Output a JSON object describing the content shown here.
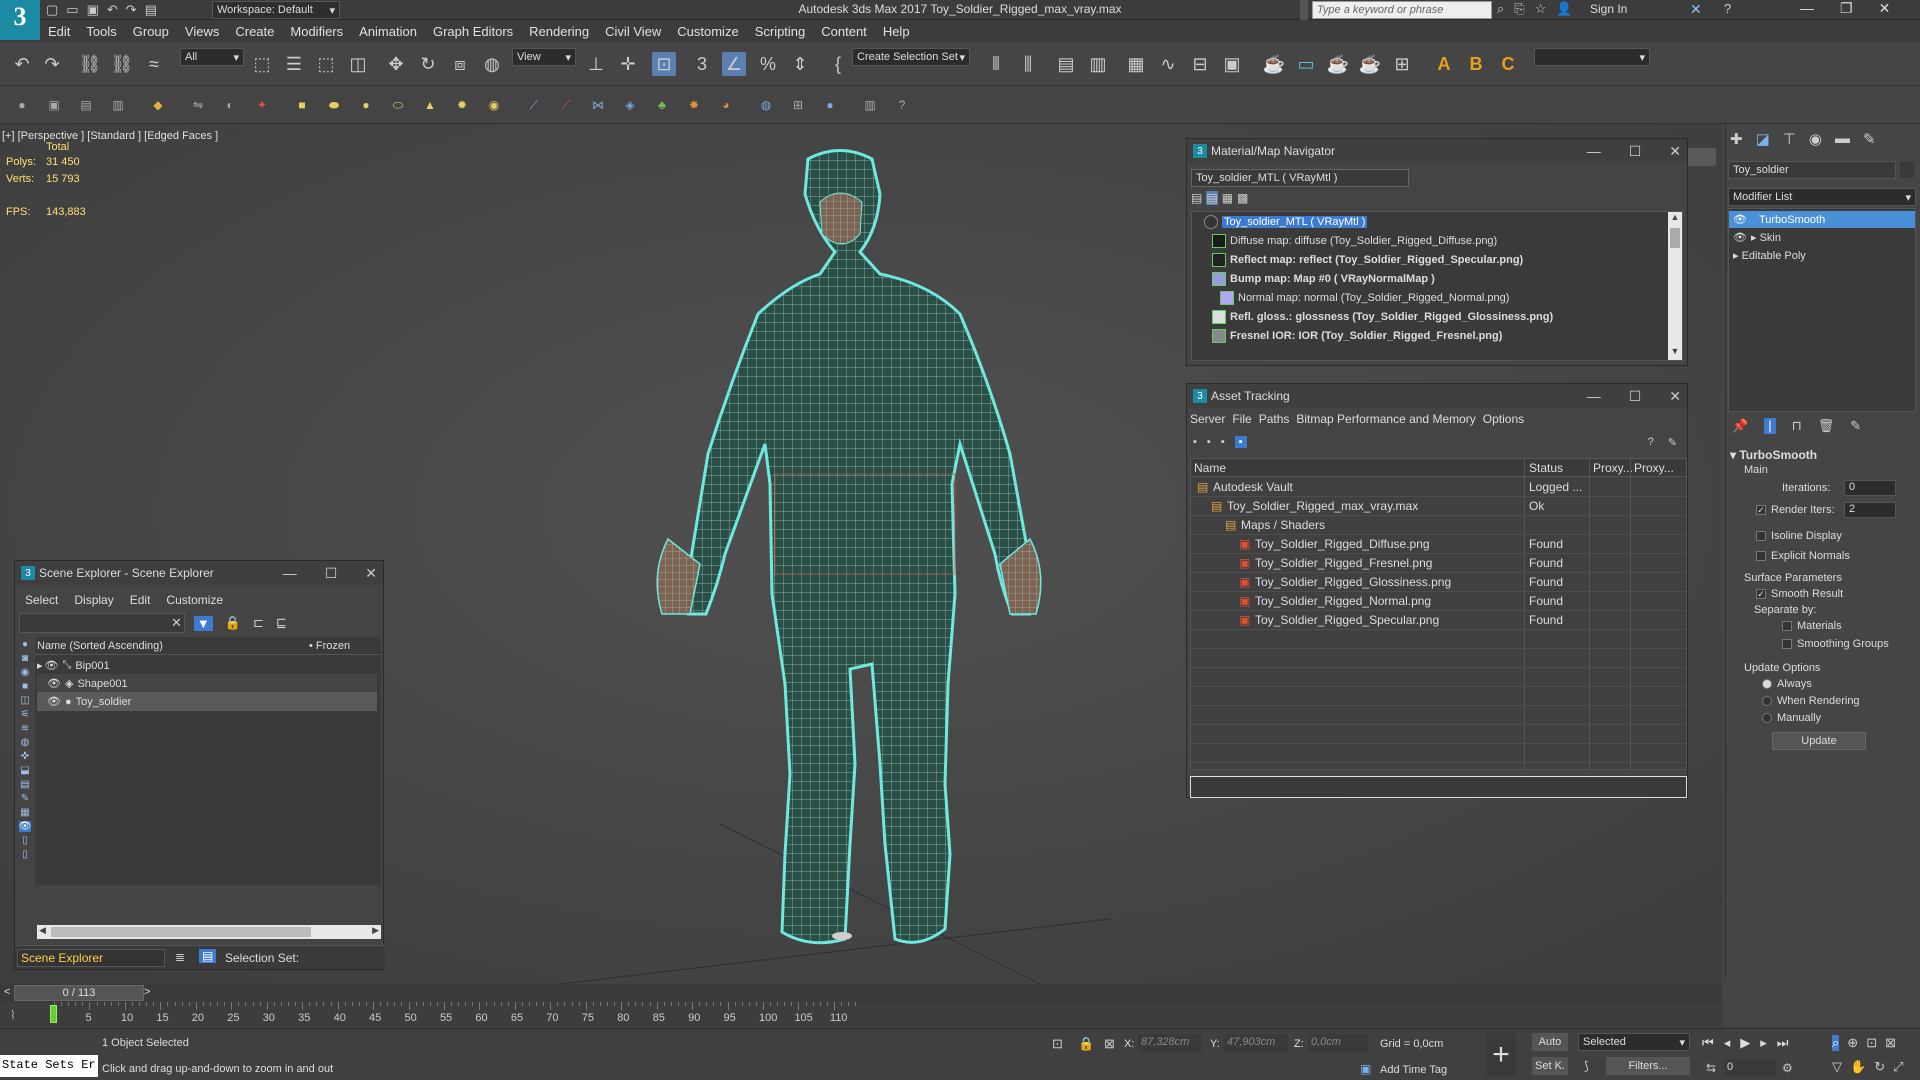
{
  "titlebar": {
    "workspace": "Workspace: Default",
    "title": "Autodesk 3ds Max 2017     Toy_Soldier_Rigged_max_vray.max",
    "search_placeholder": "Type a keyword or phrase",
    "sign_in": "Sign In"
  },
  "menus": [
    "Edit",
    "Tools",
    "Group",
    "Views",
    "Create",
    "Modifiers",
    "Animation",
    "Graph Editors",
    "Rendering",
    "Civil View",
    "Customize",
    "Scripting",
    "Content",
    "Help"
  ],
  "toolbar": {
    "filter": "All",
    "view": "View",
    "selection_set": "Create Selection Set"
  },
  "viewport": {
    "label": "[+] [Perspective ] [Standard ] [Edged Faces ]",
    "total": "Total",
    "polys_label": "Polys:",
    "polys_value": "31 450",
    "verts_label": "Verts:",
    "verts_value": "15 793",
    "fps_label": "FPS:",
    "fps_value": "143,883"
  },
  "material_navigator": {
    "title": "Material/Map Navigator",
    "field": "Toy_soldier_MTL  ( VRayMtl )",
    "items": [
      {
        "text": "Toy_soldier_MTL  ( VRayMtl )",
        "bold": false,
        "indent": 0,
        "selected": true
      },
      {
        "text": "Diffuse map: diffuse (Toy_Soldier_Rigged_Diffuse.png)",
        "bold": false,
        "indent": 1,
        "selected": false
      },
      {
        "text": "Reflect map: reflect (Toy_Soldier_Rigged_Specular.png)",
        "bold": true,
        "indent": 1,
        "selected": false
      },
      {
        "text": "Bump map: Map #0  ( VRayNormalMap )",
        "bold": true,
        "indent": 1,
        "selected": false
      },
      {
        "text": "Normal map: normal (Toy_Soldier_Rigged_Normal.png)",
        "bold": false,
        "indent": 2,
        "selected": false
      },
      {
        "text": "Refl. gloss.: glossness (Toy_Soldier_Rigged_Glossiness.png)",
        "bold": true,
        "indent": 1,
        "selected": false
      },
      {
        "text": "Fresnel IOR: IOR (Toy_Soldier_Rigged_Fresnel.png)",
        "bold": true,
        "indent": 1,
        "selected": false
      }
    ]
  },
  "asset_tracking": {
    "title": "Asset Tracking",
    "menus": [
      "Server",
      "File",
      "Paths",
      "Bitmap Performance and Memory",
      "Options"
    ],
    "columns": [
      "Name",
      "Status",
      "Proxy...",
      "Proxy..."
    ],
    "rows": [
      {
        "name": "Autodesk Vault",
        "status": "Logged ...",
        "indent": 0
      },
      {
        "name": "Toy_Soldier_Rigged_max_vray.max",
        "status": "Ok",
        "indent": 1
      },
      {
        "name": "Maps / Shaders",
        "status": "",
        "indent": 2
      },
      {
        "name": "Toy_Soldier_Rigged_Diffuse.png",
        "status": "Found",
        "indent": 3
      },
      {
        "name": "Toy_Soldier_Rigged_Fresnel.png",
        "status": "Found",
        "indent": 3
      },
      {
        "name": "Toy_Soldier_Rigged_Glossiness.png",
        "status": "Found",
        "indent": 3
      },
      {
        "name": "Toy_Soldier_Rigged_Normal.png",
        "status": "Found",
        "indent": 3
      },
      {
        "name": "Toy_Soldier_Rigged_Specular.png",
        "status": "Found",
        "indent": 3
      }
    ]
  },
  "scene_explorer": {
    "title": "Scene Explorer - Scene Explorer",
    "menus": [
      "Select",
      "Display",
      "Edit",
      "Customize"
    ],
    "col_name": "Name (Sorted Ascending)",
    "col_frozen": "• Frozen",
    "items": [
      "Bip001",
      "Shape001",
      "Toy_soldier"
    ],
    "footer_name": "Scene Explorer",
    "selection_set": "Selection Set:"
  },
  "command_panel": {
    "object_name": "Toy_soldier",
    "modifier_list": "Modifier List",
    "stack": [
      "TurboSmooth",
      "Skin",
      "Editable Poly"
    ],
    "rollout": "TurboSmooth",
    "main": "Main",
    "iterations_label": "Iterations:",
    "iterations": "0",
    "render_iters_label": "Render Iters:",
    "render_iters": "2",
    "isoline": "Isoline Display",
    "explicit_normals": "Explicit Normals",
    "surface_params": "Surface Parameters",
    "smooth_result": "Smooth Result",
    "separate_by": "Separate by:",
    "materials": "Materials",
    "smoothing_groups": "Smoothing Groups",
    "update_options": "Update Options",
    "always": "Always",
    "when_rendering": "When Rendering",
    "manually": "Manually",
    "update": "Update"
  },
  "timeline": {
    "frame": "0 / 113",
    "ticks": [
      "0",
      "5",
      "10",
      "15",
      "20",
      "25",
      "30",
      "35",
      "40",
      "45",
      "50",
      "55",
      "60",
      "65",
      "70",
      "75",
      "80",
      "85",
      "90",
      "95",
      "100",
      "105",
      "110"
    ]
  },
  "status": {
    "maxscript": "State Sets Er",
    "selected": "1 Object Selected",
    "prompt": "Click and drag up-and-down to zoom in and out",
    "x_label": "X:",
    "x_value": "87,328cm",
    "y_label": "Y:",
    "y_value": "47,903cm",
    "z_label": "Z:",
    "z_value": "0,0cm",
    "grid": "Grid = 0,0cm",
    "add_time_tag": "Add Time Tag",
    "auto": "Auto",
    "selected_dd": "Selected",
    "setk": "Set K.",
    "filters": "Filters...",
    "frame_value": "0"
  },
  "colors": {
    "accent": "#4a90d9",
    "wire": "#6fe8e0",
    "select": "#3d7bd1"
  }
}
